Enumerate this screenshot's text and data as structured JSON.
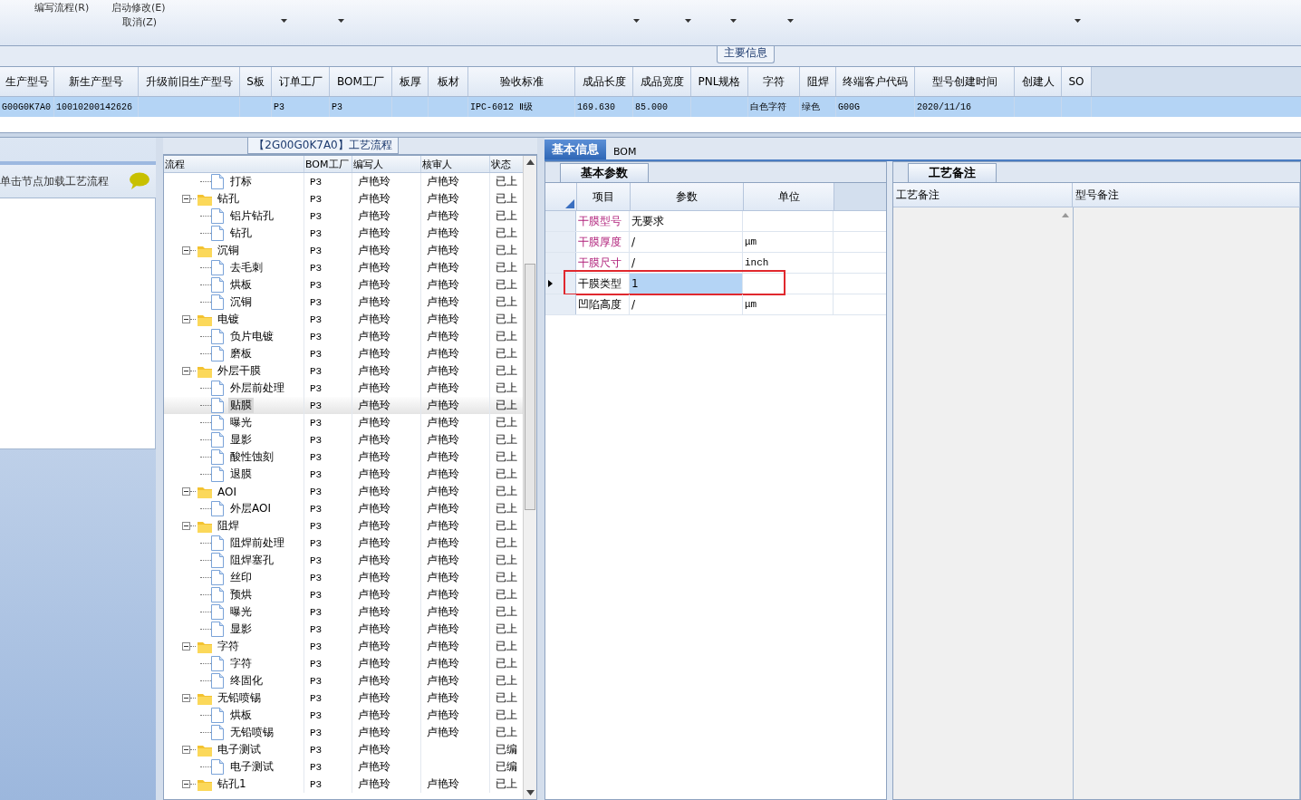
{
  "toolbar": {
    "commands": [
      {
        "label": "编写流程(R)"
      },
      {
        "label": "启动修改(E)"
      },
      {
        "label": "取消(Z)"
      }
    ]
  },
  "main_info": {
    "title": "主要信息",
    "columns": [
      "生产型号",
      "新生产型号",
      "升级前旧生产型号",
      "S板",
      "订单工厂",
      "BOM工厂",
      "板厚",
      "板材",
      "验收标准",
      "成品长度",
      "成品宽度",
      "PNL规格",
      "字符",
      "阻焊",
      "终端客户代码",
      "型号创建时间",
      "创建人",
      "SO"
    ],
    "row": {
      "selected": true,
      "cells": [
        "G00G0K7A0",
        "10010200142626",
        "",
        "",
        "P3",
        "P3",
        "",
        "",
        "IPC-6012 Ⅱ级",
        "169.630",
        "85.000",
        "",
        "白色字符",
        "绿色",
        "G00G",
        "2020/11/16",
        "",
        ""
      ]
    }
  },
  "left_panel": {
    "hint": "单击节点加载工艺流程"
  },
  "process": {
    "title": "【2G00G0K7A0】工艺流程",
    "columns": [
      "流程",
      "BOM工厂",
      "编写人",
      "核审人",
      "状态"
    ],
    "tree": [
      {
        "kind": "file",
        "label": "打标",
        "bom": "P3",
        "writer": "卢艳玲",
        "reviewer": "卢艳玲",
        "status": "已上",
        "selected": false
      },
      {
        "kind": "folder",
        "label": "钻孔",
        "bom": "P3",
        "writer": "卢艳玲",
        "reviewer": "卢艳玲",
        "status": "已上",
        "selected": false,
        "expanded": true,
        "children": [
          {
            "kind": "file",
            "label": "铝片钻孔",
            "bom": "P3",
            "writer": "卢艳玲",
            "reviewer": "卢艳玲",
            "status": "已上",
            "selected": false
          },
          {
            "kind": "file",
            "label": "钻孔",
            "bom": "P3",
            "writer": "卢艳玲",
            "reviewer": "卢艳玲",
            "status": "已上",
            "selected": false
          }
        ]
      },
      {
        "kind": "folder",
        "label": "沉铜",
        "bom": "P3",
        "writer": "卢艳玲",
        "reviewer": "卢艳玲",
        "status": "已上",
        "selected": false,
        "expanded": true,
        "children": [
          {
            "kind": "file",
            "label": "去毛刺",
            "bom": "P3",
            "writer": "卢艳玲",
            "reviewer": "卢艳玲",
            "status": "已上",
            "selected": false
          },
          {
            "kind": "file",
            "label": "烘板",
            "bom": "P3",
            "writer": "卢艳玲",
            "reviewer": "卢艳玲",
            "status": "已上",
            "selected": false
          },
          {
            "kind": "file",
            "label": "沉铜",
            "bom": "P3",
            "writer": "卢艳玲",
            "reviewer": "卢艳玲",
            "status": "已上",
            "selected": false
          }
        ]
      },
      {
        "kind": "folder",
        "label": "电镀",
        "bom": "P3",
        "writer": "卢艳玲",
        "reviewer": "卢艳玲",
        "status": "已上",
        "selected": false,
        "expanded": true,
        "children": [
          {
            "kind": "file",
            "label": "负片电镀",
            "bom": "P3",
            "writer": "卢艳玲",
            "reviewer": "卢艳玲",
            "status": "已上",
            "selected": false
          },
          {
            "kind": "file",
            "label": "磨板",
            "bom": "P3",
            "writer": "卢艳玲",
            "reviewer": "卢艳玲",
            "status": "已上",
            "selected": false
          }
        ]
      },
      {
        "kind": "folder",
        "label": "外层干膜",
        "bom": "P3",
        "writer": "卢艳玲",
        "reviewer": "卢艳玲",
        "status": "已上",
        "selected": false,
        "expanded": true,
        "children": [
          {
            "kind": "file",
            "label": "外层前处理",
            "bom": "P3",
            "writer": "卢艳玲",
            "reviewer": "卢艳玲",
            "status": "已上",
            "selected": false
          },
          {
            "kind": "file",
            "label": "贴膜",
            "bom": "P3",
            "writer": "卢艳玲",
            "reviewer": "卢艳玲",
            "status": "已上",
            "selected": true
          },
          {
            "kind": "file",
            "label": "曝光",
            "bom": "P3",
            "writer": "卢艳玲",
            "reviewer": "卢艳玲",
            "status": "已上",
            "selected": false
          },
          {
            "kind": "file",
            "label": "显影",
            "bom": "P3",
            "writer": "卢艳玲",
            "reviewer": "卢艳玲",
            "status": "已上",
            "selected": false
          },
          {
            "kind": "file",
            "label": "酸性蚀刻",
            "bom": "P3",
            "writer": "卢艳玲",
            "reviewer": "卢艳玲",
            "status": "已上",
            "selected": false
          },
          {
            "kind": "file",
            "label": "退膜",
            "bom": "P3",
            "writer": "卢艳玲",
            "reviewer": "卢艳玲",
            "status": "已上",
            "selected": false
          }
        ]
      },
      {
        "kind": "folder",
        "label": "AOI",
        "bom": "P3",
        "writer": "卢艳玲",
        "reviewer": "卢艳玲",
        "status": "已上",
        "selected": false,
        "expanded": true,
        "children": [
          {
            "kind": "file",
            "label": "外层AOI",
            "bom": "P3",
            "writer": "卢艳玲",
            "reviewer": "卢艳玲",
            "status": "已上",
            "selected": false
          }
        ]
      },
      {
        "kind": "folder",
        "label": "阻焊",
        "bom": "P3",
        "writer": "卢艳玲",
        "reviewer": "卢艳玲",
        "status": "已上",
        "selected": false,
        "expanded": true,
        "children": [
          {
            "kind": "file",
            "label": "阻焊前处理",
            "bom": "P3",
            "writer": "卢艳玲",
            "reviewer": "卢艳玲",
            "status": "已上",
            "selected": false
          },
          {
            "kind": "file",
            "label": "阻焊塞孔",
            "bom": "P3",
            "writer": "卢艳玲",
            "reviewer": "卢艳玲",
            "status": "已上",
            "selected": false
          },
          {
            "kind": "file",
            "label": "丝印",
            "bom": "P3",
            "writer": "卢艳玲",
            "reviewer": "卢艳玲",
            "status": "已上",
            "selected": false
          },
          {
            "kind": "file",
            "label": "预烘",
            "bom": "P3",
            "writer": "卢艳玲",
            "reviewer": "卢艳玲",
            "status": "已上",
            "selected": false
          },
          {
            "kind": "file",
            "label": "曝光",
            "bom": "P3",
            "writer": "卢艳玲",
            "reviewer": "卢艳玲",
            "status": "已上",
            "selected": false
          },
          {
            "kind": "file",
            "label": "显影",
            "bom": "P3",
            "writer": "卢艳玲",
            "reviewer": "卢艳玲",
            "status": "已上",
            "selected": false
          }
        ]
      },
      {
        "kind": "folder",
        "label": "字符",
        "bom": "P3",
        "writer": "卢艳玲",
        "reviewer": "卢艳玲",
        "status": "已上",
        "selected": false,
        "expanded": true,
        "children": [
          {
            "kind": "file",
            "label": "字符",
            "bom": "P3",
            "writer": "卢艳玲",
            "reviewer": "卢艳玲",
            "status": "已上",
            "selected": false
          },
          {
            "kind": "file",
            "label": "终固化",
            "bom": "P3",
            "writer": "卢艳玲",
            "reviewer": "卢艳玲",
            "status": "已上",
            "selected": false
          }
        ]
      },
      {
        "kind": "folder",
        "label": "无铅喷锡",
        "bom": "P3",
        "writer": "卢艳玲",
        "reviewer": "卢艳玲",
        "status": "已上",
        "selected": false,
        "expanded": true,
        "children": [
          {
            "kind": "file",
            "label": "烘板",
            "bom": "P3",
            "writer": "卢艳玲",
            "reviewer": "卢艳玲",
            "status": "已上",
            "selected": false
          },
          {
            "kind": "file",
            "label": "无铅喷锡",
            "bom": "P3",
            "writer": "卢艳玲",
            "reviewer": "卢艳玲",
            "status": "已上",
            "selected": false
          }
        ]
      },
      {
        "kind": "folder",
        "label": "电子测试",
        "bom": "P3",
        "writer": "卢艳玲",
        "status": "已编",
        "selected": false,
        "expanded": true,
        "children": [
          {
            "kind": "file",
            "label": "电子测试",
            "bom": "P3",
            "writer": "卢艳玲",
            "status": "已编",
            "selected": false
          }
        ]
      },
      {
        "kind": "folder",
        "label": "钻孔1",
        "bom": "P3",
        "writer": "卢艳玲",
        "reviewer": "卢艳玲",
        "status": "已上",
        "selected": false,
        "expanded": true
      }
    ]
  },
  "detail_tabs": [
    {
      "label": "基本信息",
      "selected": true
    },
    {
      "label": "BOM",
      "selected": false
    }
  ],
  "params": {
    "tab": "基本参数",
    "columns": [
      "项目",
      "参数",
      "单位"
    ],
    "rows": [
      {
        "item": "干膜型号",
        "value": "无要求",
        "unit": "",
        "required": true,
        "current": false,
        "outlined": false
      },
      {
        "item": "干膜厚度",
        "value": "/",
        "unit": "μm",
        "required": true,
        "current": false,
        "outlined": false
      },
      {
        "item": "干膜尺寸",
        "value": "/",
        "unit": "inch",
        "required": true,
        "current": false,
        "outlined": false
      },
      {
        "item": "干膜类型",
        "value": "1",
        "unit": "",
        "required": false,
        "current": true,
        "outlined": true
      },
      {
        "item": "凹陷高度",
        "value": "/",
        "unit": "μm",
        "required": false,
        "current": false,
        "outlined": false
      }
    ]
  },
  "notes": {
    "tab": "工艺备注",
    "columns": [
      "工艺备注",
      "型号备注"
    ]
  }
}
